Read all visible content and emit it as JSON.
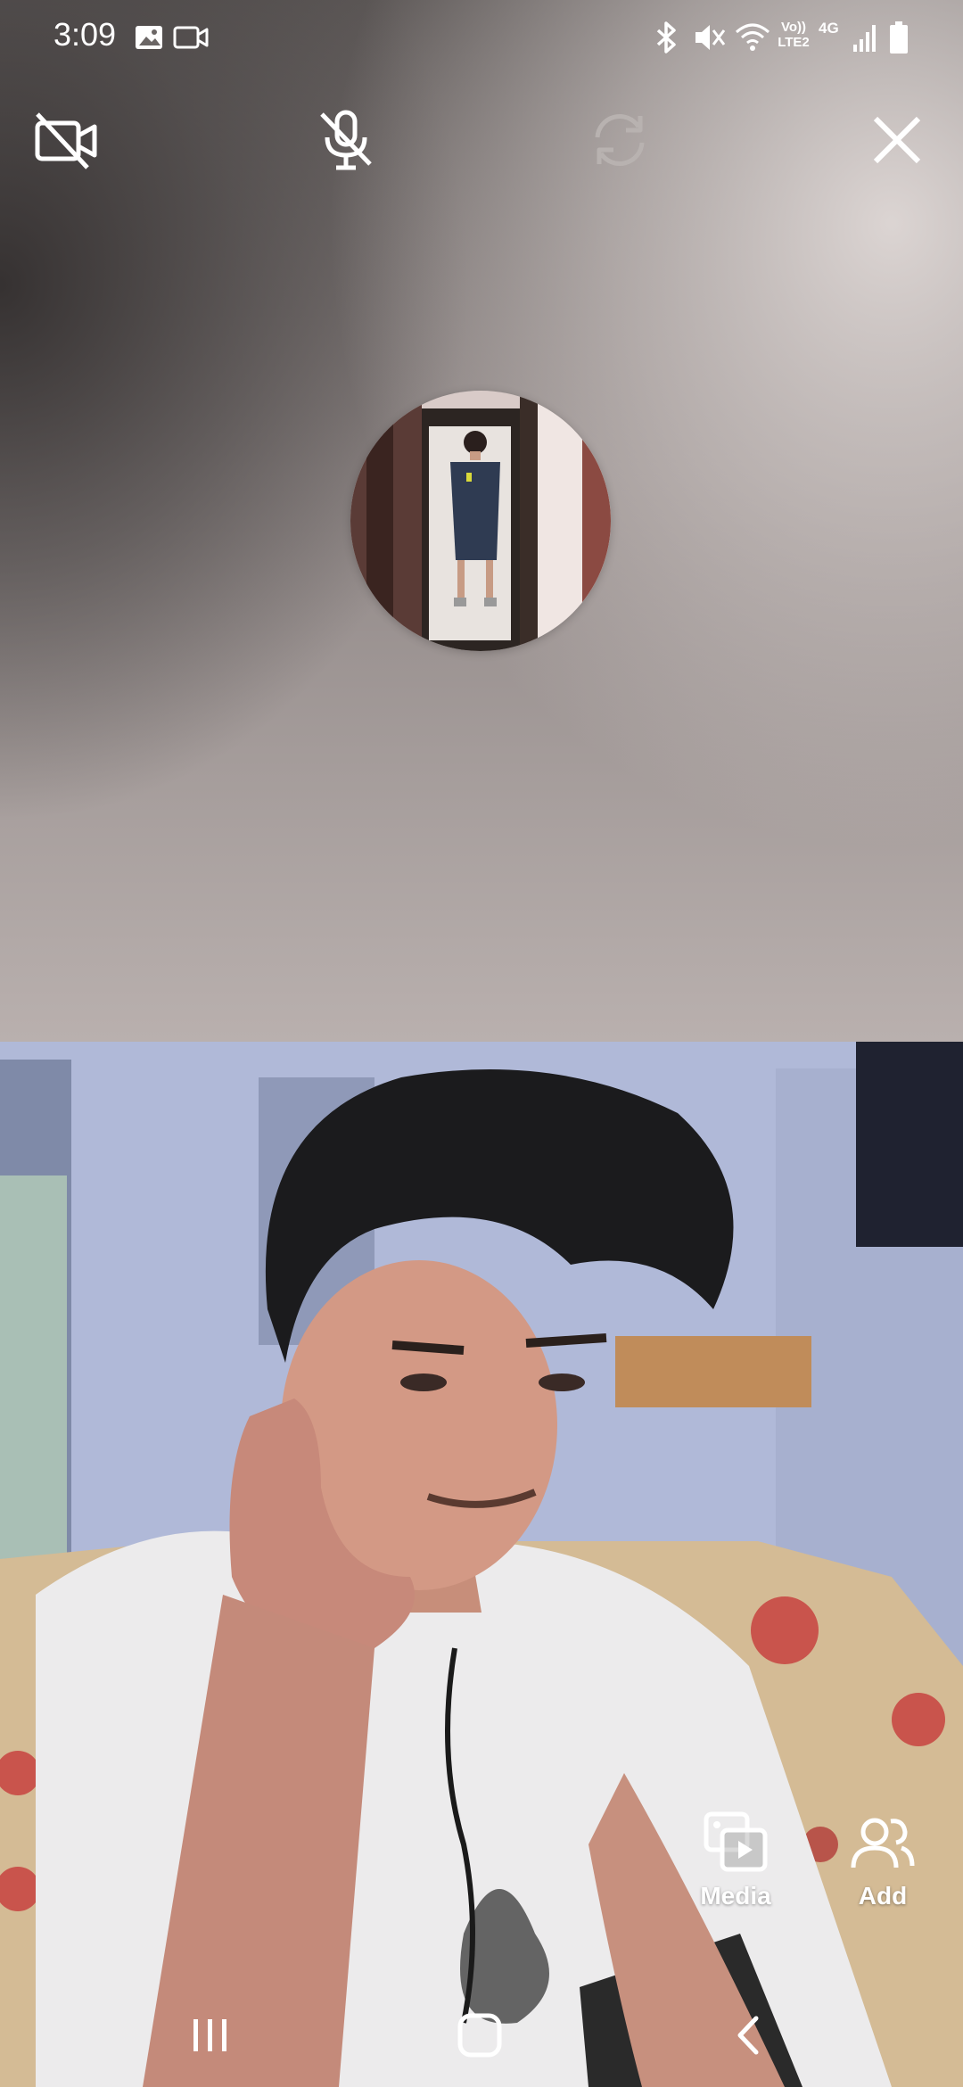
{
  "status_bar": {
    "time": "3:09",
    "network_labels": {
      "volte": "Vo))",
      "lte": "LTE2",
      "gen": "4G"
    },
    "icons": [
      "gallery-icon",
      "video-recorder-icon",
      "bluetooth-icon",
      "mute-icon",
      "wifi-icon",
      "signal-icon",
      "battery-icon"
    ]
  },
  "call_controls": {
    "camera_off": "video-off-icon",
    "mic_off": "mic-off-icon",
    "switch_camera": "switch-camera-icon",
    "end_call": "close-icon"
  },
  "actions": {
    "media_label": "Media",
    "add_label": "Add"
  },
  "navigation": [
    "recent-apps-icon",
    "home-icon",
    "back-icon"
  ],
  "colors": {
    "icon": "#ffffff",
    "disabled_icon": "#b8b2b0"
  }
}
